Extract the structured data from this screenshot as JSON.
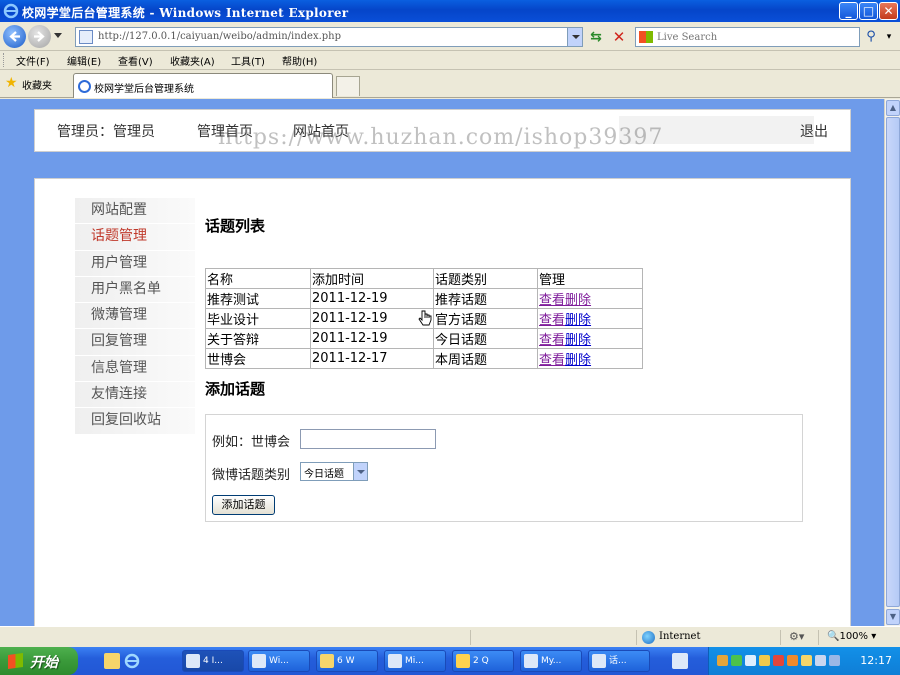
{
  "window": {
    "title": "校网学堂后台管理系统 - Windows Internet Explorer",
    "buttons": {
      "minimize": "_",
      "maximize": "□",
      "close": "✕"
    }
  },
  "address": {
    "url": "http://127.0.0.1/caiyuan/weibo/admin/index.php",
    "search_placeholder": "Live Search"
  },
  "menu": [
    "文件(F)",
    "编辑(E)",
    "查看(V)",
    "收藏夹(A)",
    "工具(T)",
    "帮助(H)"
  ],
  "favorites": {
    "label": "收藏夹",
    "tab_title": "校网学堂后台管理系统"
  },
  "page": {
    "admin_label": "管理员：管理员",
    "nav": [
      "管理首页",
      "网站首页"
    ],
    "logout": "退出",
    "sidebar": [
      "网站配置",
      "话题管理",
      "用户管理",
      "用户黑名单",
      "微薄管理",
      "回复管理",
      "信息管理",
      "友情连接",
      "回复回收站"
    ],
    "active_sidebar_index": 1,
    "list_title": "话题列表",
    "table": {
      "headers": [
        "名称",
        "添加时间",
        "话题类别",
        "管理"
      ],
      "rows": [
        {
          "name": "推荐测试",
          "date": "2011-12-19",
          "category": "推荐话题",
          "view": "查看",
          "delete": "删除"
        },
        {
          "name": "毕业设计",
          "date": "2011-12-19",
          "category": "官方话题",
          "view": "查看",
          "delete": "删除"
        },
        {
          "name": "关于答辩",
          "date": "2011-12-19",
          "category": "今日话题",
          "view": "查看",
          "delete": "删除"
        },
        {
          "name": "世博会",
          "date": "2011-12-17",
          "category": "本周话题",
          "view": "查看",
          "delete": "删除"
        }
      ]
    },
    "add_title": "添加话题",
    "form": {
      "name_label": "例如：世博会",
      "name_value": "",
      "category_label": "微博话题类别",
      "category_value": "今日话题",
      "submit_label": "添加话题"
    },
    "watermark": "https://www.huzhan.com/ishop39397"
  },
  "status": {
    "zone": "Internet",
    "zoom": "100%"
  },
  "taskbar": {
    "start": "开始",
    "buttons": [
      "4 I...",
      "Wi...",
      "6 W",
      "Mi...",
      "2 Q",
      "My...",
      "话..."
    ],
    "clock": "12:17"
  },
  "colors": {
    "page_bg": "#6E9BEA",
    "active_sidebar": "#C0392B",
    "link": "#0000CC",
    "visited_link": "#7F1D9B"
  }
}
